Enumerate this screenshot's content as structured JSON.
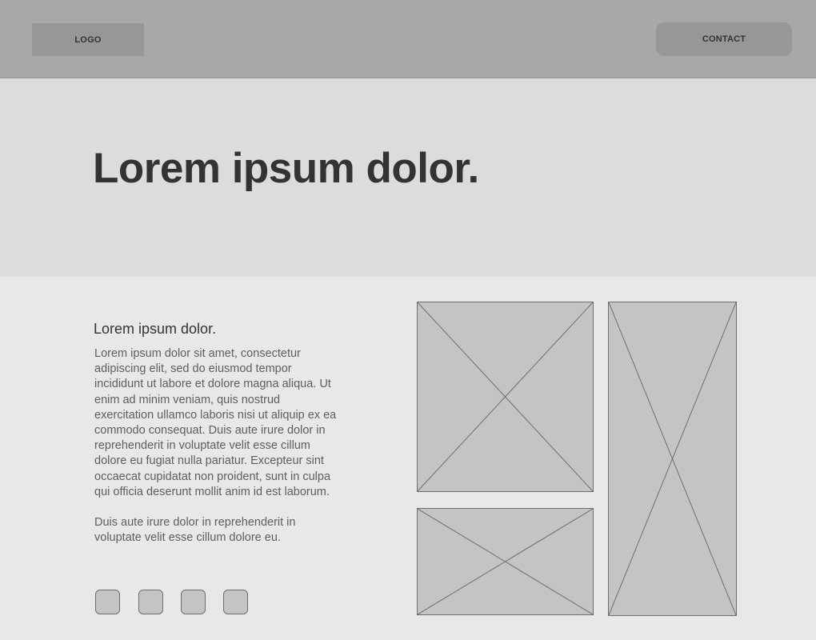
{
  "header": {
    "logo_label": "LOGO",
    "contact_label": "CONTACT"
  },
  "hero": {
    "title": "Lorem ipsum dolor."
  },
  "content": {
    "subheading": "Lorem ipsum dolor.",
    "paragraph_1": "Lorem ipsum dolor sit amet, consectetur adipiscing elit, sed do eiusmod tempor incididunt ut labore et dolore magna aliqua. Ut enim ad minim veniam, quis nostrud exercitation ullamco laboris nisi ut aliquip ex ea commodo consequat. Duis aute irure dolor in reprehenderit in voluptate velit esse cillum dolore eu fugiat nulla pariatur. Excepteur sint occaecat cupidatat non proident, sunt in culpa qui officia deserunt mollit anim id est laborum.",
    "paragraph_2": "Duis aute irure dolor in reprehenderit in voluptate velit esse cillum dolore eu.",
    "social_icons": [
      "social-icon-1",
      "social-icon-2",
      "social-icon-3",
      "social-icon-4"
    ],
    "image_placeholders": [
      "image-placeholder-top-left",
      "image-placeholder-bottom-left",
      "image-placeholder-tall-right"
    ]
  },
  "colors": {
    "header_bg": "#a8a8a8",
    "hero_bg": "#dcdcdc",
    "content_bg": "#e8e8e8",
    "placeholder_fill": "#c4c4c4",
    "text_dark": "#333333",
    "text_body": "#5e5e5e"
  }
}
